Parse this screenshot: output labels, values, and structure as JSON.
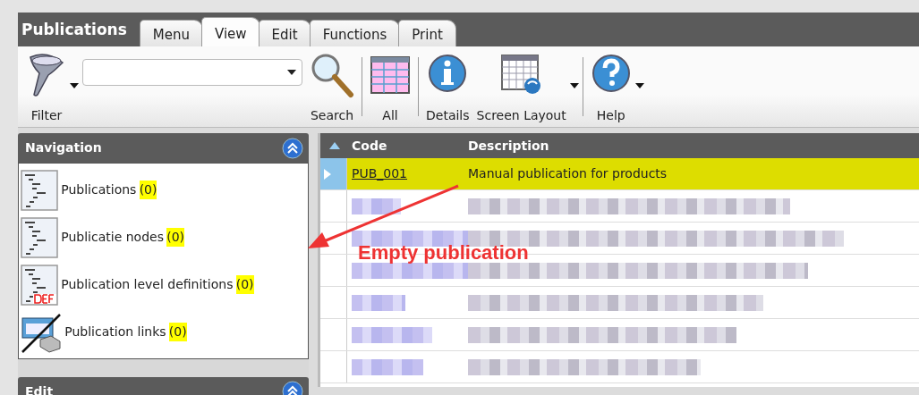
{
  "window": {
    "title": "Publications"
  },
  "tabs": [
    {
      "label": "Menu",
      "selected": false
    },
    {
      "label": "View",
      "selected": true
    },
    {
      "label": "Edit",
      "selected": false
    },
    {
      "label": "Functions",
      "selected": false
    },
    {
      "label": "Print",
      "selected": false
    }
  ],
  "toolbar": [
    {
      "kind": "button",
      "label": "Filter",
      "dropdown": true
    },
    {
      "kind": "combo"
    },
    {
      "kind": "button",
      "label": "Search",
      "dropdown": false
    },
    {
      "kind": "separator"
    },
    {
      "kind": "button",
      "label": "All",
      "dropdown": false
    },
    {
      "kind": "separator"
    },
    {
      "kind": "button",
      "label": "Details",
      "dropdown": false
    },
    {
      "kind": "button",
      "label": "Screen Layout",
      "dropdown": true
    },
    {
      "kind": "separator"
    },
    {
      "kind": "button",
      "label": "Help",
      "dropdown": true
    }
  ],
  "navigation": {
    "title": "Navigation",
    "items": [
      {
        "label": "Publications",
        "count": "(0)"
      },
      {
        "label": "Publicatie nodes",
        "count": "(0)"
      },
      {
        "label": "Publication level definitions",
        "count": "(0)"
      },
      {
        "label": "Publication links",
        "count": "(0)"
      }
    ]
  },
  "edit_panel": {
    "title": "Edit"
  },
  "table": {
    "columns": [
      {
        "label": "Code",
        "sorted": true
      },
      {
        "label": "Description",
        "sorted": false
      }
    ],
    "rows": [
      {
        "kind": "record",
        "code": "PUB_001",
        "description": "Manual publication for products",
        "selected": true
      },
      {
        "kind": "redacted",
        "selected": false
      },
      {
        "kind": "redacted",
        "selected": false
      },
      {
        "kind": "redacted",
        "selected": false
      },
      {
        "kind": "redacted",
        "selected": false
      },
      {
        "kind": "redacted",
        "selected": false
      },
      {
        "kind": "redacted",
        "selected": false
      }
    ]
  },
  "annotation": {
    "text": "Empty publication"
  }
}
